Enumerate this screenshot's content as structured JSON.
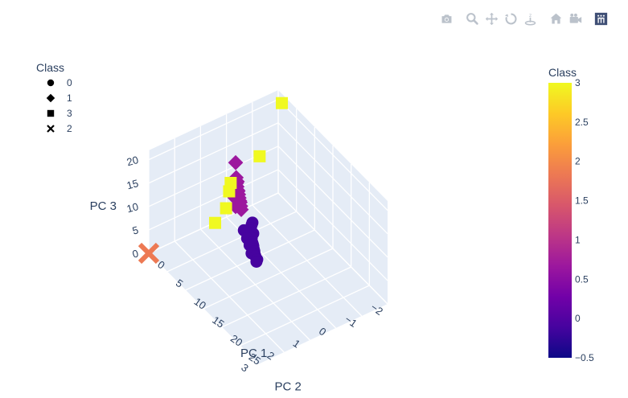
{
  "modebar": {
    "buttons": [
      {
        "name": "camera-icon"
      },
      {
        "name": "zoom-icon"
      },
      {
        "name": "pan-icon"
      },
      {
        "name": "orbit-rotate-icon"
      },
      {
        "name": "turntable-icon"
      },
      {
        "name": "home-icon"
      },
      {
        "name": "camera-last-save-icon"
      },
      {
        "name": "plotly-logo-icon"
      }
    ]
  },
  "legend": {
    "title": "Class",
    "items": [
      {
        "label": "0",
        "symbol": "circle"
      },
      {
        "label": "1",
        "symbol": "diamond"
      },
      {
        "label": "3",
        "symbol": "square"
      },
      {
        "label": "2",
        "symbol": "x"
      }
    ]
  },
  "colorbar": {
    "title": "Class",
    "min": -0.5,
    "max": 3,
    "ticks": [
      "3",
      "2.5",
      "2",
      "1.5",
      "1",
      "0.5",
      "0",
      "−0.5"
    ],
    "colors": [
      "#0d0887",
      "#46039f",
      "#7201a8",
      "#9c179e",
      "#bd3786",
      "#d8576b",
      "#ed7953",
      "#fb9f3a",
      "#fdca26",
      "#f0f921"
    ]
  },
  "chart_data": {
    "type": "scatter3d",
    "axes": {
      "x": {
        "title": "PC 1",
        "ticks": [
          "0",
          "5",
          "10",
          "15",
          "20",
          "25"
        ],
        "range": [
          0,
          30
        ]
      },
      "y": {
        "title": "PC 2",
        "ticks": [
          "−2",
          "−1",
          "0",
          "1",
          "2",
          "3"
        ],
        "range": [
          -2,
          3
        ]
      },
      "z": {
        "title": "PC 3",
        "ticks": [
          "0",
          "5",
          "10",
          "15",
          "20"
        ],
        "range": [
          0,
          22
        ]
      }
    },
    "series": [
      {
        "name": "0",
        "symbol": "circle",
        "color": "#46039f",
        "points": [
          [
            5.0,
            -0.3,
            2.0
          ],
          [
            5.5,
            -0.2,
            2.2
          ],
          [
            6.0,
            -0.1,
            2.1
          ],
          [
            6.5,
            0.0,
            2.3
          ],
          [
            7.0,
            -0.05,
            1.9
          ],
          [
            7.5,
            0.1,
            2.0
          ],
          [
            8.0,
            0.15,
            2.2
          ],
          [
            8.5,
            0.2,
            1.8
          ],
          [
            9.0,
            0.25,
            2.0
          ],
          [
            9.5,
            0.3,
            2.1
          ],
          [
            10.0,
            0.35,
            1.9
          ],
          [
            10.5,
            0.4,
            2.0
          ],
          [
            11.0,
            0.45,
            1.8
          ],
          [
            11.5,
            0.5,
            2.0
          ],
          [
            12.0,
            0.5,
            1.7
          ],
          [
            6.2,
            0.2,
            2.6
          ],
          [
            7.8,
            0.3,
            2.4
          ],
          [
            9.2,
            0.4,
            2.3
          ],
          [
            10.8,
            0.55,
            2.2
          ],
          [
            12.5,
            0.6,
            1.9
          ]
        ]
      },
      {
        "name": "1",
        "symbol": "diamond",
        "color": "#9c179e",
        "points": [
          [
            -3.0,
            -0.8,
            4.0
          ],
          [
            -2.0,
            -0.7,
            4.2
          ],
          [
            -1.5,
            -0.6,
            4.5
          ],
          [
            -1.0,
            -0.55,
            4.3
          ],
          [
            -0.5,
            -0.5,
            4.1
          ],
          [
            0.0,
            -0.45,
            4.4
          ],
          [
            0.5,
            -0.4,
            4.2
          ],
          [
            1.0,
            -0.35,
            4.0
          ],
          [
            1.5,
            -0.3,
            3.9
          ],
          [
            2.0,
            -0.25,
            4.1
          ],
          [
            2.5,
            -0.2,
            3.8
          ],
          [
            3.0,
            -0.15,
            3.6
          ],
          [
            -1.2,
            -0.5,
            5.0
          ],
          [
            0.2,
            -0.3,
            3.5
          ],
          [
            1.8,
            -0.1,
            3.4
          ],
          [
            -6.0,
            -1.2,
            3.8
          ]
        ]
      },
      {
        "name": "3",
        "symbol": "square",
        "color": "#f0f921",
        "points": [
          [
            4.0,
            1.0,
            4.5
          ],
          [
            2.0,
            -1.0,
            12.0
          ],
          [
            4.0,
            0.4,
            11.5
          ],
          [
            5.0,
            0.6,
            11.0
          ],
          [
            7.0,
            1.0,
            10.0
          ],
          [
            1.0,
            -2.0,
            20.0
          ]
        ]
      },
      {
        "name": "2",
        "symbol": "x",
        "color": "#ed7953",
        "points": [
          [
            0.0,
            3.0,
            0.0
          ]
        ]
      }
    ]
  }
}
